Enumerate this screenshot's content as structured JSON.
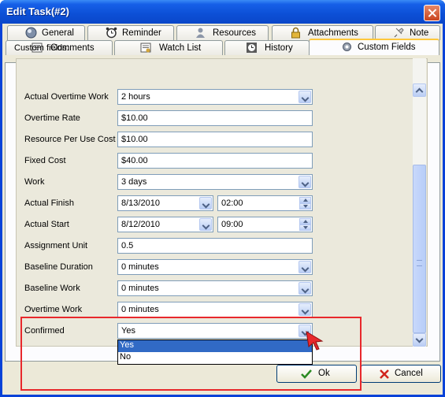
{
  "window": {
    "title": "Edit Task(#2)"
  },
  "tabs_row1": [
    {
      "label": "General",
      "icon": "general-icon"
    },
    {
      "label": "Reminder",
      "icon": "alarm-clock-icon"
    },
    {
      "label": "Resources",
      "icon": "user-icon"
    },
    {
      "label": "Attachments",
      "icon": "lock-icon"
    },
    {
      "label": "Note",
      "icon": "pin-icon"
    }
  ],
  "tabs_row2": [
    {
      "label": "Comments",
      "icon": "comments-icon"
    },
    {
      "label": "Watch List",
      "icon": "watch-list-icon"
    },
    {
      "label": "History",
      "icon": "history-icon"
    },
    {
      "label": "Custom Fields",
      "icon": "gear-icon",
      "active": true
    }
  ],
  "custom_fields": {
    "section_label": "Custom fields:",
    "rows": [
      {
        "label": "Actual Overtime Work",
        "value": "2 hours",
        "type": "dropdown"
      },
      {
        "label": "Overtime Rate",
        "value": "$10.00",
        "type": "text"
      },
      {
        "label": "Resource Per Use Cost",
        "value": "$10.00",
        "type": "text"
      },
      {
        "label": "Fixed Cost",
        "value": "$40.00",
        "type": "text"
      },
      {
        "label": "Work",
        "value": "3 days",
        "type": "dropdown"
      },
      {
        "label": "Actual Finish",
        "date": "8/13/2010",
        "time": "02:00",
        "type": "datetime"
      },
      {
        "label": "Actual Start",
        "date": "8/12/2010",
        "time": "09:00",
        "type": "datetime"
      },
      {
        "label": "Assignment Unit",
        "value": "0.5",
        "type": "text"
      },
      {
        "label": "Baseline Duration",
        "value": "0 minutes",
        "type": "dropdown"
      },
      {
        "label": "Baseline Work",
        "value": "0 minutes",
        "type": "dropdown"
      },
      {
        "label": "Overtime Work",
        "value": "0 minutes",
        "type": "dropdown"
      },
      {
        "label": "Confirmed",
        "value": "Yes",
        "type": "dropdown"
      }
    ],
    "confirmed_options": [
      "Yes",
      "No"
    ],
    "confirmed_highlighted": "Yes"
  },
  "buttons": {
    "ok": "Ok",
    "cancel": "Cancel"
  },
  "colors": {
    "highlight_box": "#e8282c",
    "selection": "#316ac5",
    "titlebar": "#0c4fd6"
  }
}
